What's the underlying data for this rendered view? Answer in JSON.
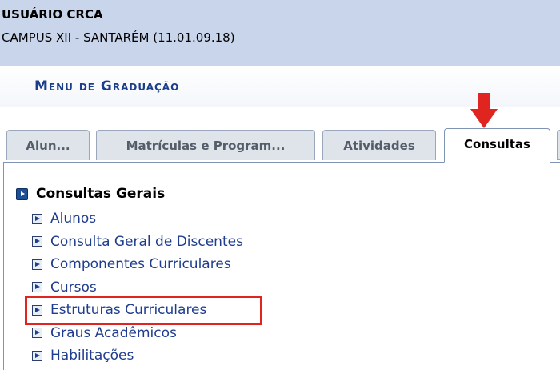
{
  "header": {
    "user_name": "USUÁRIO CRCA",
    "campus": "CAMPUS XII - SANTARÉM (11.01.09.18)"
  },
  "menu": {
    "title": "Menu de Graduação"
  },
  "tabs": [
    {
      "label": "Alun..."
    },
    {
      "label": "Matrículas e Program..."
    },
    {
      "label": "Atividades"
    },
    {
      "label": "Consultas",
      "active": true
    }
  ],
  "section": {
    "title": "Consultas Gerais",
    "items": [
      {
        "label": "Alunos"
      },
      {
        "label": "Consulta Geral de Discentes"
      },
      {
        "label": "Componentes Curriculares"
      },
      {
        "label": "Cursos"
      },
      {
        "label": "Estruturas Curriculares",
        "highlighted": true
      },
      {
        "label": "Graus Acadêmicos"
      },
      {
        "label": "Habilitações"
      }
    ]
  },
  "colors": {
    "header_bg": "#c8d5ea",
    "menu_title": "#1b3e8c",
    "link": "#1f3d8f",
    "annotation_red": "#e0241f"
  },
  "icons": {
    "annotation_arrow": "down-arrow-icon",
    "section_bullet": "blue-square-arrow-icon",
    "item_bullet": "play-square-icon"
  }
}
